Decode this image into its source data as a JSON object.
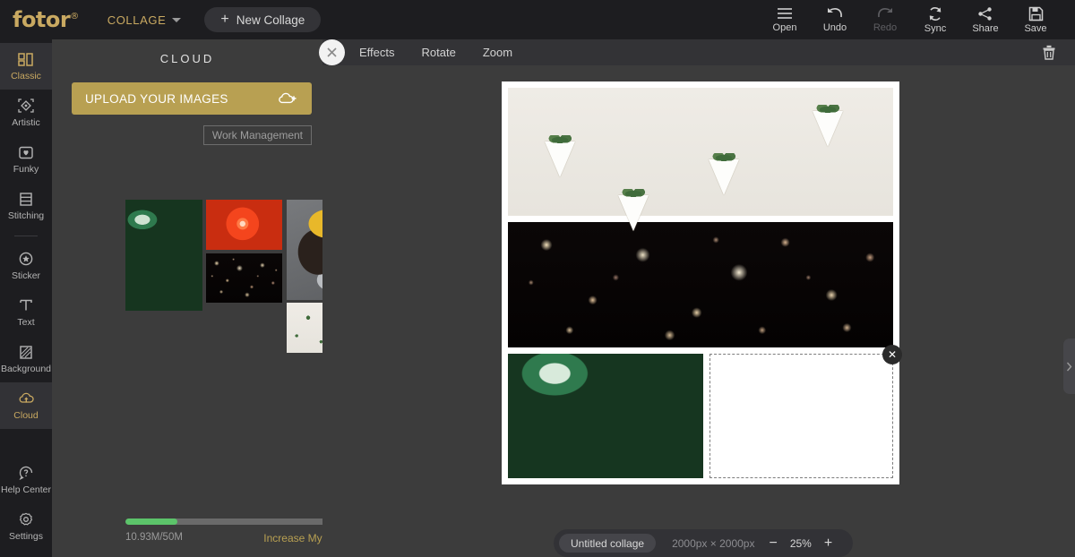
{
  "topbar": {
    "logo": "fotor",
    "logo_mark": "®",
    "menu_label": "COLLAGE",
    "new_collage_label": "New Collage",
    "plus": "+",
    "actions": [
      {
        "label": "Open",
        "icon": "hamburger-menu-icon",
        "disabled": false
      },
      {
        "label": "Undo",
        "icon": "undo-arrow-icon",
        "disabled": false
      },
      {
        "label": "Redo",
        "icon": "redo-arrow-icon",
        "disabled": true
      },
      {
        "label": "Sync",
        "icon": "sync-refresh-icon",
        "disabled": false
      },
      {
        "label": "Share",
        "icon": "share-nodes-icon",
        "disabled": false
      },
      {
        "label": "Save",
        "icon": "floppy-disk-icon",
        "disabled": false
      }
    ]
  },
  "sidebar": {
    "items": [
      {
        "label": "Classic",
        "icon": "grid-blocks-icon",
        "active": true
      },
      {
        "label": "Artistic",
        "icon": "diamond-frame-icon",
        "active": false
      },
      {
        "label": "Funky",
        "icon": "heart-square-icon",
        "active": false
      },
      {
        "label": "Stitching",
        "icon": "rows-stack-icon",
        "active": false
      },
      {
        "label": "Sticker",
        "icon": "star-circle-icon",
        "active": false
      },
      {
        "label": "Text",
        "icon": "text-t-icon",
        "active": false
      },
      {
        "label": "Background",
        "icon": "hatch-square-icon",
        "active": false
      },
      {
        "label": "Cloud",
        "icon": "cloud-upload-icon",
        "active": true
      }
    ],
    "bottom_items": [
      {
        "label": "Help Center",
        "icon": "question-circle-icon"
      },
      {
        "label": "Settings",
        "icon": "gear-icon"
      }
    ]
  },
  "panel": {
    "title": "CLOUD",
    "upload_label": "UPLOAD YOUR IMAGES",
    "upload_icon": "cloud-plus-icon",
    "work_management_label": "Work Management",
    "thumbnails": [
      {
        "name": "green-leaves-thumbnail",
        "art": "leaves-art"
      },
      {
        "name": "orange-slices-thumbnail",
        "art": "orange-art"
      },
      {
        "name": "bokeh-lights-thumbnail",
        "art": "bokeh-art"
      },
      {
        "name": "pug-hat-thumbnail",
        "art": "pug-art"
      },
      {
        "name": "hanging-planters-thumbnail",
        "art": "planter-art"
      }
    ],
    "storage": {
      "used_label": "10.93M/50M",
      "percent": 22,
      "increase_label": "Increase My Storage",
      "bar_color": "#5cc46a"
    }
  },
  "canvas_toolbar": {
    "close_icon": "close-x-icon",
    "items": [
      "Effects",
      "Rotate",
      "Zoom"
    ],
    "trash_icon": "trash-delete-icon"
  },
  "canvas": {
    "cells": [
      {
        "name": "collage-cell-hanging-planters",
        "art": "wall-art",
        "filled": true
      },
      {
        "name": "collage-cell-bokeh-lights",
        "art": "bokeh-big",
        "filled": true
      },
      {
        "name": "collage-cell-green-leaves",
        "art": "leaves-big",
        "filled": true
      },
      {
        "name": "collage-cell-empty-dropzone",
        "art": "",
        "filled": false
      }
    ],
    "cell_remove_icon": "remove-cell-x-icon",
    "panel_handle_icon": "chevron-right-icon"
  },
  "bottom_bar": {
    "collage_name": "Untitled collage",
    "dimensions": "2000px × 2000px",
    "zoom_out": "−",
    "zoom_level": "25%",
    "zoom_in": "+"
  },
  "colors": {
    "brand_gold": "#c9a961",
    "upload_gold": "#b8a052",
    "storage_green": "#5cc46a",
    "topbar_bg": "#1d1d20",
    "panel_bg": "#3c3c3c"
  }
}
